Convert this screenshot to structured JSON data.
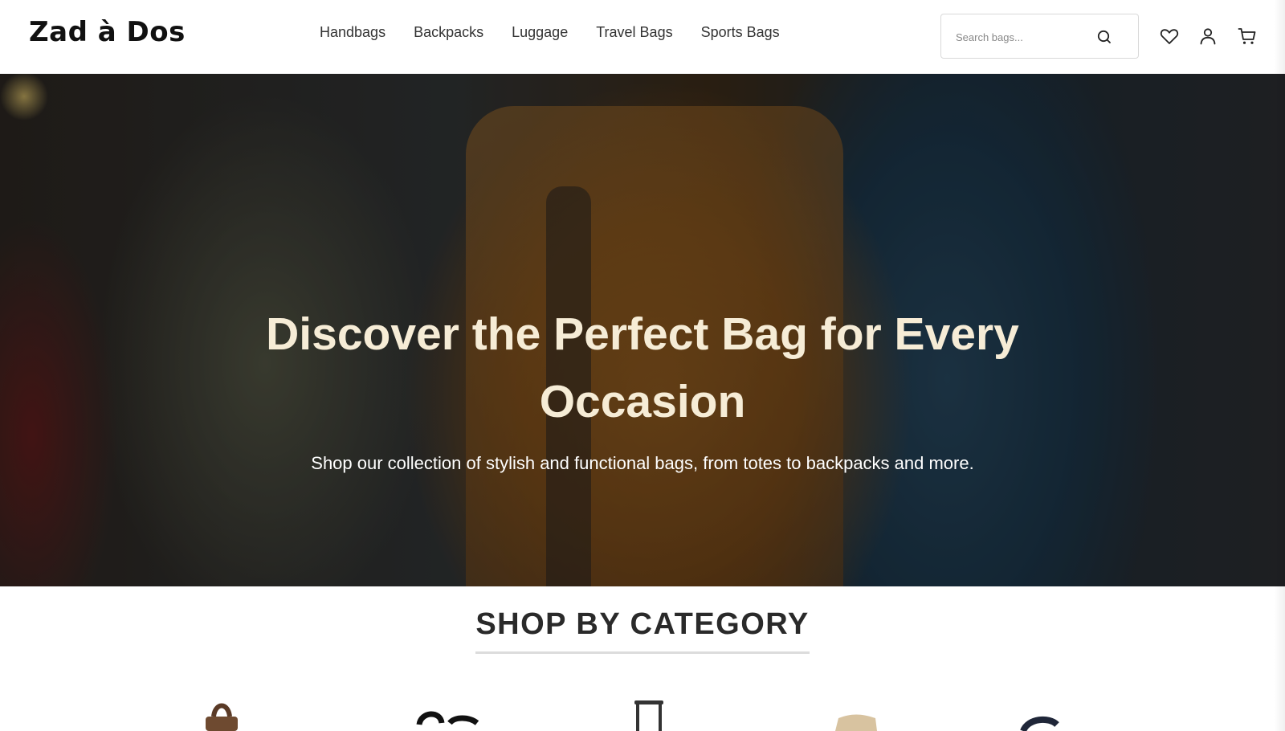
{
  "header": {
    "logo": "Zad à Dos",
    "nav": [
      "Handbags",
      "Backpacks",
      "Luggage",
      "Travel Bags",
      "Sports Bags"
    ],
    "search": {
      "placeholder": "Search bags...",
      "icon": "search-icon"
    },
    "icons": [
      "heart-icon",
      "user-icon",
      "cart-icon"
    ]
  },
  "hero": {
    "title": "Discover the Perfect Bag for Every Occasion",
    "subtitle": "Shop our collection of stylish and functional bags, from totes to backpacks and more.",
    "title_color": "#f6ecd6"
  },
  "categories": {
    "heading": "SHOP BY CATEGORY",
    "items": [
      "handbag-image",
      "backpack-image",
      "luggage-image",
      "travel-bag-image",
      "sports-bag-image"
    ]
  }
}
